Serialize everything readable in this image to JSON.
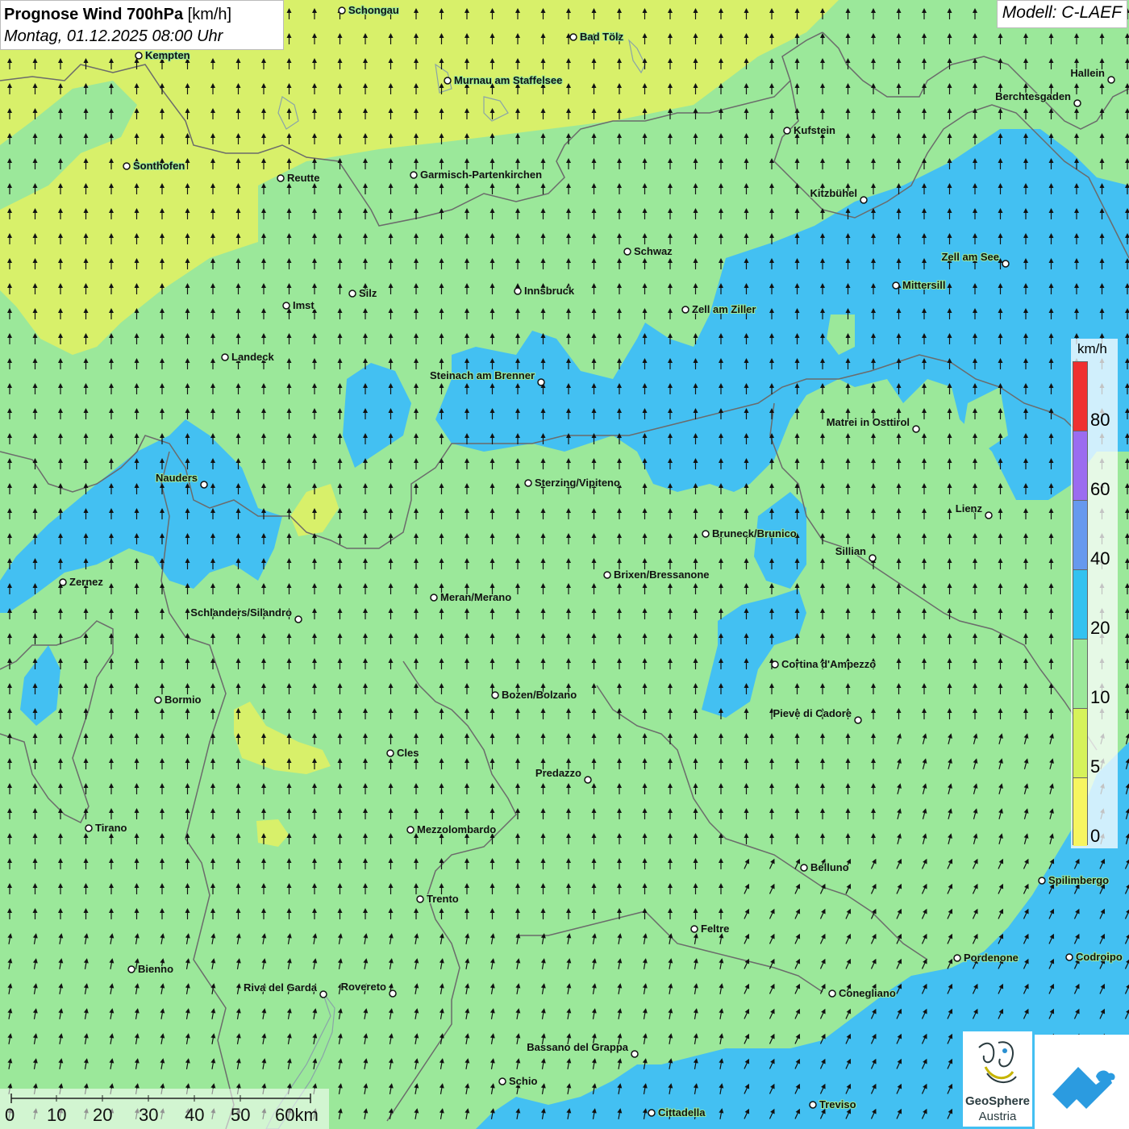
{
  "header": {
    "title_bold": "Prognose Wind 700hPa",
    "title_unit": "[km/h]",
    "datetime": "Montag, 01.12.2025 08:00 Uhr"
  },
  "model": {
    "label": "Modell: C-LAEF"
  },
  "legend": {
    "unit": "km/h",
    "colors": [
      "#ef3030",
      "#9b6cf0",
      "#6699ee",
      "#33c2f0",
      "#9be89a",
      "#d6f25a",
      "#f7f560"
    ],
    "ticks": [
      "80",
      "60",
      "40",
      "20",
      "10",
      "5",
      "0"
    ]
  },
  "scale": {
    "labels": [
      "0",
      "10",
      "20",
      "30",
      "40",
      "50",
      "60km"
    ]
  },
  "logos": {
    "geosphere_name": "GeoSphere",
    "geosphere_sub": "Austria"
  },
  "colors": {
    "green": "#9be89a",
    "blue": "#43c0f2",
    "yellow": "#d8f06a",
    "border": "#6b6b6b"
  },
  "wind_arrows": {
    "direction": "north",
    "speed_category_dominant": "10-20 km/h"
  },
  "cities": [
    {
      "name": "Schongau"
    },
    {
      "name": "Bad Tölz"
    },
    {
      "name": "Kempten"
    },
    {
      "name": "Murnau am Staffelsee"
    },
    {
      "name": "Hallein"
    },
    {
      "name": "Berchtesgaden"
    },
    {
      "name": "Kufstein"
    },
    {
      "name": "Sonthofen"
    },
    {
      "name": "Reutte"
    },
    {
      "name": "Garmisch-Partenkirchen"
    },
    {
      "name": "Kitzbühel"
    },
    {
      "name": "Schwaz"
    },
    {
      "name": "Zell am See"
    },
    {
      "name": "Silz"
    },
    {
      "name": "Innsbruck"
    },
    {
      "name": "Mittersill"
    },
    {
      "name": "Imst"
    },
    {
      "name": "Zell am Ziller"
    },
    {
      "name": "Landeck"
    },
    {
      "name": "Steinach am Brenner"
    },
    {
      "name": "Matrei in Osttirol"
    },
    {
      "name": "Nauders"
    },
    {
      "name": "Sterzing/Vipiteno"
    },
    {
      "name": "Lienz"
    },
    {
      "name": "Bruneck/Brunico"
    },
    {
      "name": "Sillian"
    },
    {
      "name": "Zernez"
    },
    {
      "name": "Brixen/Bressanone"
    },
    {
      "name": "Meran/Merano"
    },
    {
      "name": "Schlanders/Silandro"
    },
    {
      "name": "Cortina d'Ampezzo"
    },
    {
      "name": "Bozen/Bolzano"
    },
    {
      "name": "Bormio"
    },
    {
      "name": "Pieve di Cadore"
    },
    {
      "name": "Cles"
    },
    {
      "name": "Predazzo"
    },
    {
      "name": "Tirano"
    },
    {
      "name": "Mezzolombardo"
    },
    {
      "name": "Belluno"
    },
    {
      "name": "Spilimbergo"
    },
    {
      "name": "Trento"
    },
    {
      "name": "Feltre"
    },
    {
      "name": "Pordenone"
    },
    {
      "name": "Codroipo"
    },
    {
      "name": "Bienno"
    },
    {
      "name": "Riva del Garda"
    },
    {
      "name": "Rovereto"
    },
    {
      "name": "Conegliano"
    },
    {
      "name": "Bassano del Grappa"
    },
    {
      "name": "Schio"
    },
    {
      "name": "Treviso"
    },
    {
      "name": "Cittadella"
    }
  ]
}
